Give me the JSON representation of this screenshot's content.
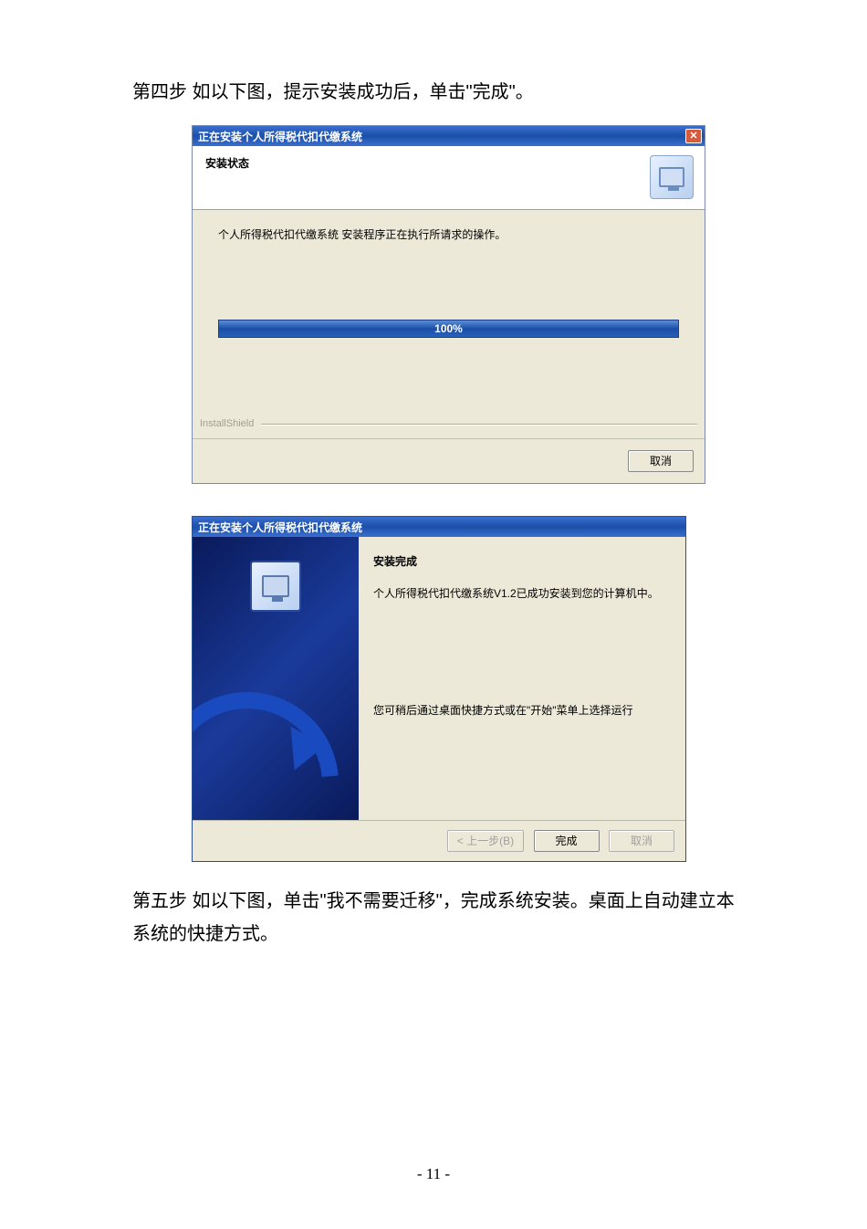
{
  "doc": {
    "step4_text": "第四步   如以下图，提示安装成功后，单击\"完成\"。",
    "step5_text": "第五步   如以下图，单击\"我不需要迁移\"，完成系统安装。桌面上自动建立本系统的快捷方式。",
    "page_number": "- 11 -"
  },
  "dialog1": {
    "title": "正在安装个人所得税代扣代缴系统",
    "close_symbol": "✕",
    "header_title": "安装状态",
    "body_text": "个人所得税代扣代缴系统 安装程序正在执行所请求的操作。",
    "progress_label": "100%",
    "installshield_label": "InstallShield",
    "cancel_label": "取消"
  },
  "dialog2": {
    "title": "正在安装个人所得税代扣代缴系统",
    "complete_title": "安装完成",
    "complete_text": "个人所得税代扣代缴系统V1.2已成功安装到您的计算机中。",
    "hint_text": "您可稍后通过桌面快捷方式或在\"开始\"菜单上选择运行",
    "back_label": "< 上一步(B)",
    "finish_label": "完成",
    "cancel_label": "取消"
  }
}
